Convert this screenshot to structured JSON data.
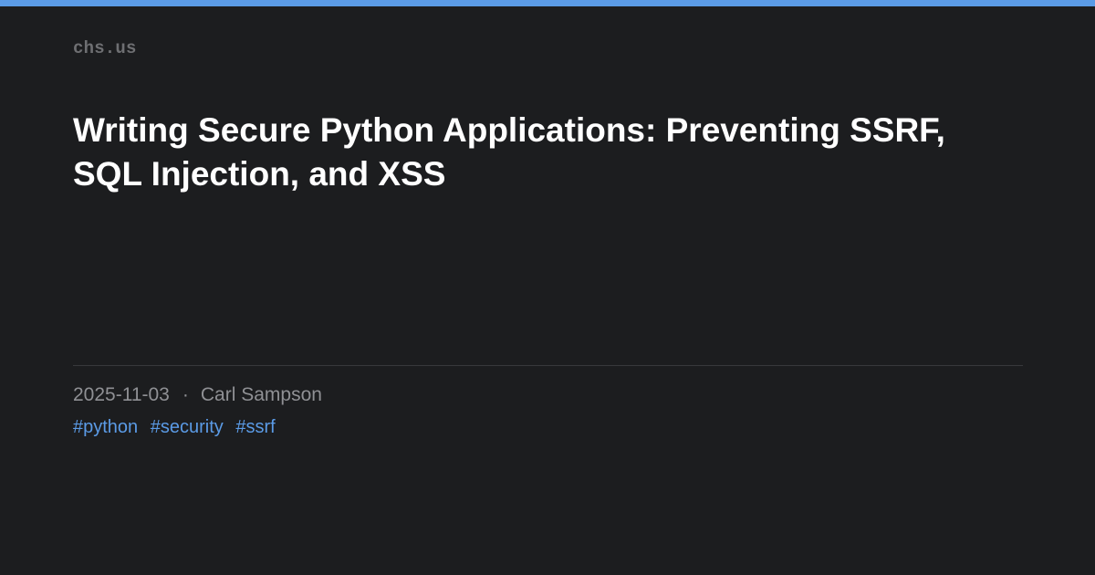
{
  "site": {
    "name": "chs.us"
  },
  "post": {
    "title": "Writing Secure Python Applications: Preventing SSRF, SQL Injection, and XSS",
    "date": "2025-11-03",
    "separator": "·",
    "author": "Carl Sampson",
    "tags": [
      "#python",
      "#security",
      "#ssrf"
    ]
  },
  "colors": {
    "background": "#1c1d1f",
    "accent": "#5b9be6",
    "title": "#ffffff",
    "meta": "#8f9094",
    "site_name": "#6e6f72"
  }
}
